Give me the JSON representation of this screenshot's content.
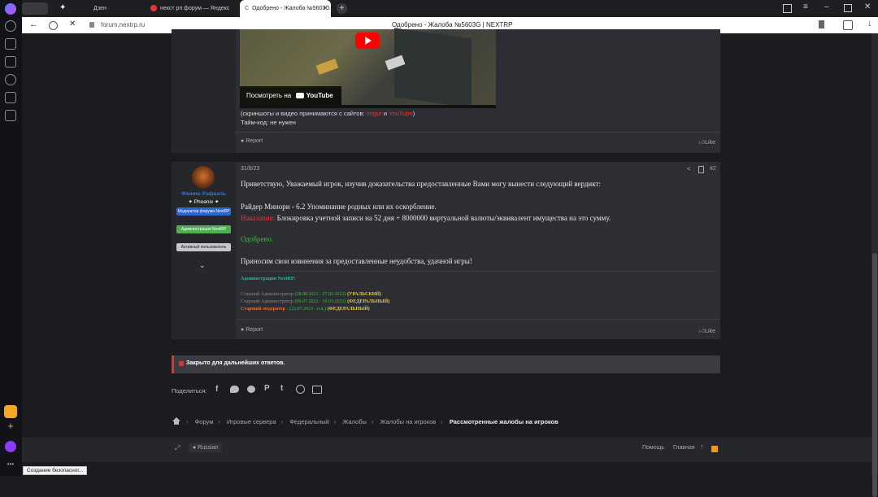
{
  "browser": {
    "tabs": [
      {
        "label": "Дзен"
      },
      {
        "label": "некст рп форум — Яндекс"
      },
      {
        "label": "Одобрено - Жалоба №5603G"
      }
    ],
    "url": "forum.nextrp.ru",
    "page_title": "Одобрено - Жалоба №5603G | NEXTRP",
    "status_tooltip": "Создание безопасног..."
  },
  "post1": {
    "video_watch_label": "Посмотреть на",
    "video_brand": "YouTube",
    "note_prefix": "(скриншоты и видео принимаются с сайтов:",
    "note_imgur": "Imgur",
    "note_and": "и",
    "note_youtube": "YouTube",
    "note_suffix": ")",
    "timecode": "Тайм-код: не нужен",
    "report": "Report",
    "like": "Like"
  },
  "post2": {
    "date": "31/8/23",
    "number": "#2",
    "username": "Феникс Рафаэль",
    "usertitle": "✦ Phoenix ✦",
    "badges": [
      "Модератор форума NextRP",
      "Администрация NextRP",
      "Активный пользователь"
    ],
    "greeting": "Приветствую, Уважаемый игрок, изучив доказательства предоставленные Вами могу вынести следующий вердикт:",
    "verdict_line": "Райдер Минори - 6.2 Упоминание родных или их оскорбление.",
    "punishment_label": "Наказание:",
    "punishment_text": "Блокировка учетной записи на 52 дня + 8000000 виртуальной валюты/эквивалент имущества на это сумму.",
    "status": "Одобрено.",
    "closing": "Приносим свои извинения за предоставленные неудобства, удачной игры!",
    "sig_title": "Администрация NextRP:",
    "sig_lines": [
      {
        "role": "Старший Администратор",
        "dates": "(28.08.2021 - 07.02.2022)",
        "tag": "(УРАЛЬСКИЙ)"
      },
      {
        "role": "Старший Администратор",
        "dates": "(09.07.2022 - 19.03.2023)",
        "tag": "(ФЕДЕРАЛЬНЫЙ)"
      },
      {
        "role": "Старший модератор -",
        "dates": "(22.07.2023 - н.в.)",
        "tag": "(ФЕДЕРАЛЬНЫЙ)"
      }
    ],
    "report": "Report",
    "like": "Like"
  },
  "closed_notice": "Закрыто для дальнейших ответов.",
  "share_label": "Поделиться:",
  "breadcrumbs": [
    "Форум",
    "Игровые сервера",
    "Федеральный",
    "Жалобы",
    "Жалобы на игроков",
    "Рассмотренные жалобы на игроков"
  ],
  "footer": {
    "language": "Russian",
    "help": "Помощь",
    "home": "Главная"
  }
}
